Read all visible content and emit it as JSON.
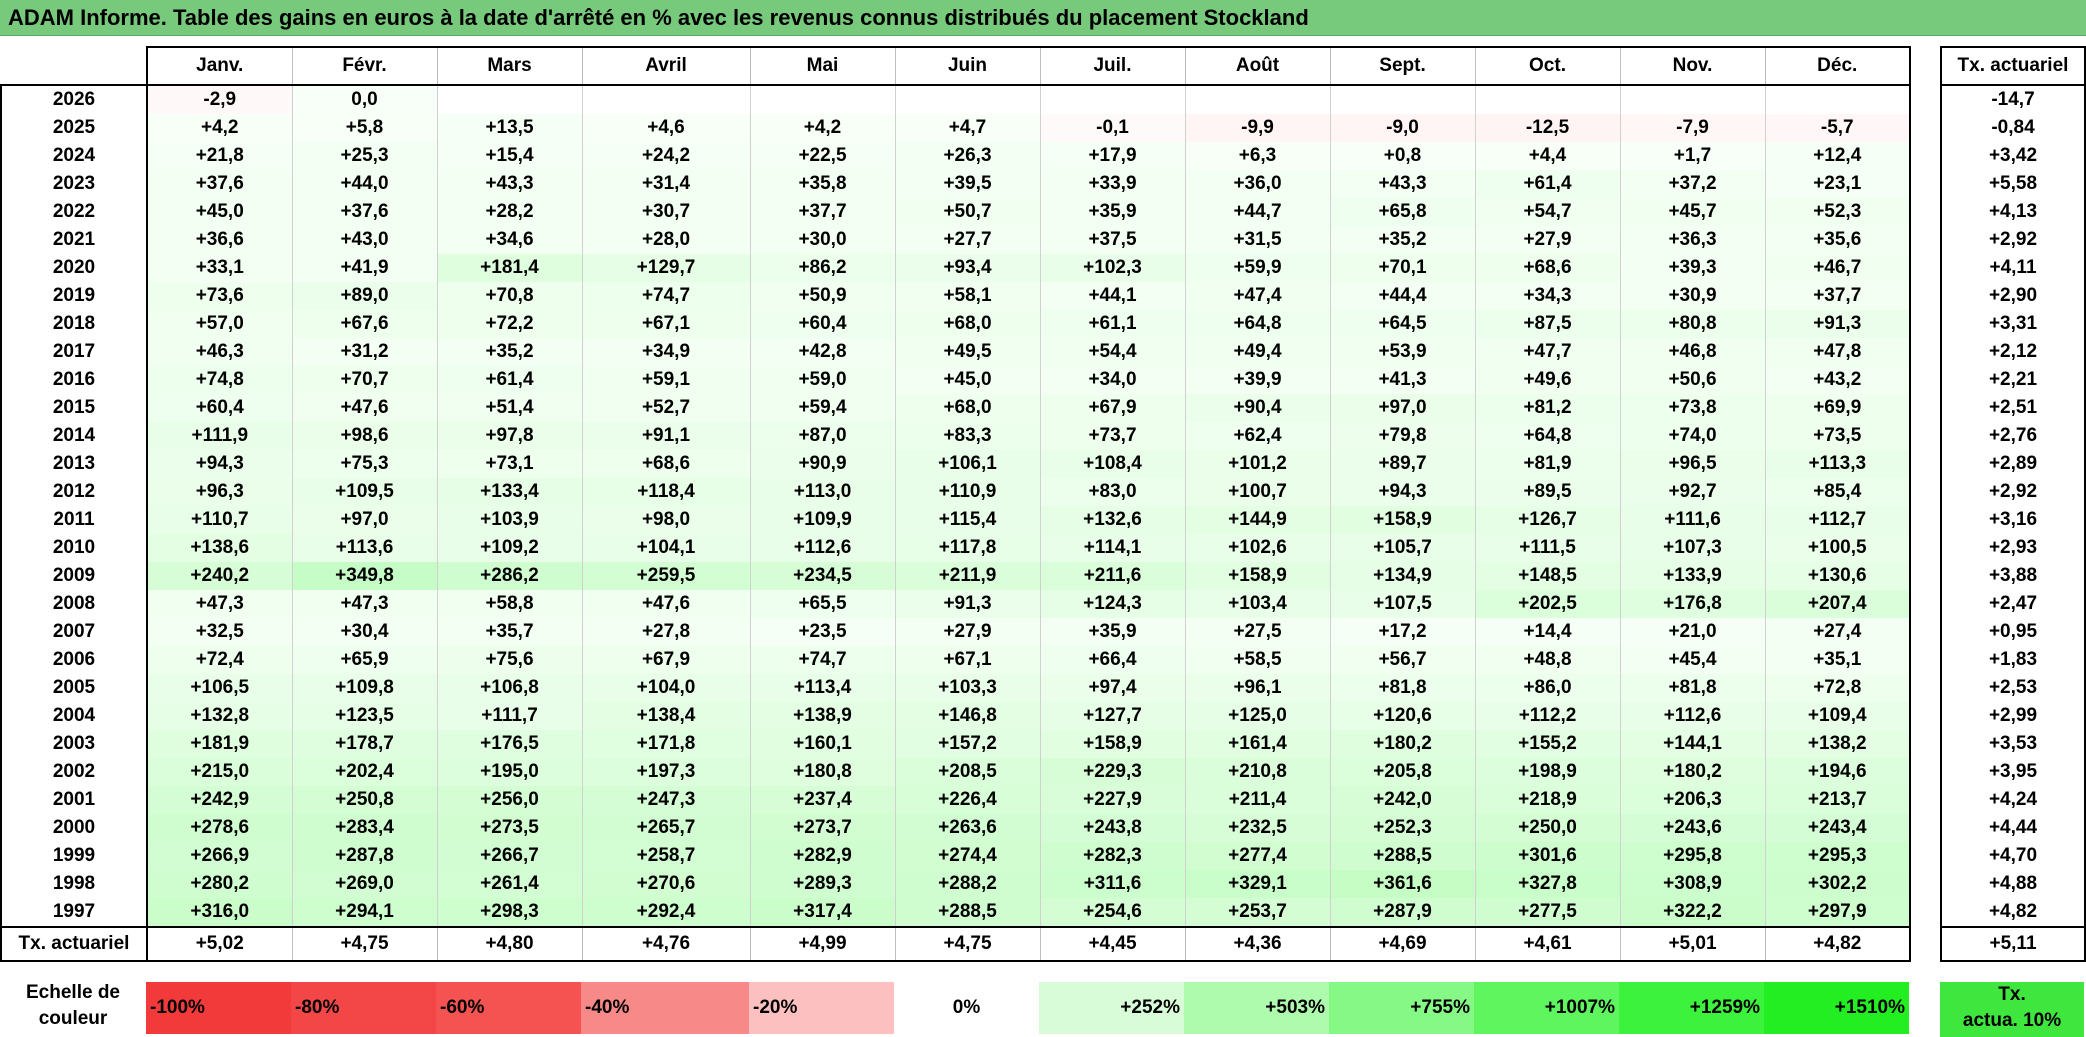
{
  "title": "ADAM Informe. Table des gains en euros à la date d'arrêté en % avec les revenus connus distribués du placement Stockland",
  "colors": {
    "title_bg": "#77c97b",
    "rate_extra_bg": "#3ee63e"
  },
  "chart_data": {
    "type": "table",
    "title": "ADAM Informe. Table des gains en euros à la date d'arrêté en % avec les revenus connus distribués du placement Stockland",
    "months": [
      "Janv.",
      "Févr.",
      "Mars",
      "Avril",
      "Mai",
      "Juin",
      "Juil.",
      "Août",
      "Sept.",
      "Oct.",
      "Nov.",
      "Déc."
    ],
    "rate_header": "Tx. actuariel",
    "rows": [
      {
        "year": "2026",
        "values": [
          "-2,9",
          "0,0",
          "",
          "",
          "",
          "",
          "",
          "",
          "",
          "",
          "",
          ""
        ],
        "rate": "-14,7"
      },
      {
        "year": "2025",
        "values": [
          "+4,2",
          "+5,8",
          "+13,5",
          "+4,6",
          "+4,2",
          "+4,7",
          "-0,1",
          "-9,9",
          "-9,0",
          "-12,5",
          "-7,9",
          "-5,7"
        ],
        "rate": "-0,84"
      },
      {
        "year": "2024",
        "values": [
          "+21,8",
          "+25,3",
          "+15,4",
          "+24,2",
          "+22,5",
          "+26,3",
          "+17,9",
          "+6,3",
          "+0,8",
          "+4,4",
          "+1,7",
          "+12,4"
        ],
        "rate": "+3,42"
      },
      {
        "year": "2023",
        "values": [
          "+37,6",
          "+44,0",
          "+43,3",
          "+31,4",
          "+35,8",
          "+39,5",
          "+33,9",
          "+36,0",
          "+43,3",
          "+61,4",
          "+37,2",
          "+23,1"
        ],
        "rate": "+5,58"
      },
      {
        "year": "2022",
        "values": [
          "+45,0",
          "+37,6",
          "+28,2",
          "+30,7",
          "+37,7",
          "+50,7",
          "+35,9",
          "+44,7",
          "+65,8",
          "+54,7",
          "+45,7",
          "+52,3"
        ],
        "rate": "+4,13"
      },
      {
        "year": "2021",
        "values": [
          "+36,6",
          "+43,0",
          "+34,6",
          "+28,0",
          "+30,0",
          "+27,7",
          "+37,5",
          "+31,5",
          "+35,2",
          "+27,9",
          "+36,3",
          "+35,6"
        ],
        "rate": "+2,92"
      },
      {
        "year": "2020",
        "values": [
          "+33,1",
          "+41,9",
          "+181,4",
          "+129,7",
          "+86,2",
          "+93,4",
          "+102,3",
          "+59,9",
          "+70,1",
          "+68,6",
          "+39,3",
          "+46,7"
        ],
        "rate": "+4,11"
      },
      {
        "year": "2019",
        "values": [
          "+73,6",
          "+89,0",
          "+70,8",
          "+74,7",
          "+50,9",
          "+58,1",
          "+44,1",
          "+47,4",
          "+44,4",
          "+34,3",
          "+30,9",
          "+37,7"
        ],
        "rate": "+2,90"
      },
      {
        "year": "2018",
        "values": [
          "+57,0",
          "+67,6",
          "+72,2",
          "+67,1",
          "+60,4",
          "+68,0",
          "+61,1",
          "+64,8",
          "+64,5",
          "+87,5",
          "+80,8",
          "+91,3"
        ],
        "rate": "+3,31"
      },
      {
        "year": "2017",
        "values": [
          "+46,3",
          "+31,2",
          "+35,2",
          "+34,9",
          "+42,8",
          "+49,5",
          "+54,4",
          "+49,4",
          "+53,9",
          "+47,7",
          "+46,8",
          "+47,8"
        ],
        "rate": "+2,12"
      },
      {
        "year": "2016",
        "values": [
          "+74,8",
          "+70,7",
          "+61,4",
          "+59,1",
          "+59,0",
          "+45,0",
          "+34,0",
          "+39,9",
          "+41,3",
          "+49,6",
          "+50,6",
          "+43,2"
        ],
        "rate": "+2,21"
      },
      {
        "year": "2015",
        "values": [
          "+60,4",
          "+47,6",
          "+51,4",
          "+52,7",
          "+59,4",
          "+68,0",
          "+67,9",
          "+90,4",
          "+97,0",
          "+81,2",
          "+73,8",
          "+69,9"
        ],
        "rate": "+2,51"
      },
      {
        "year": "2014",
        "values": [
          "+111,9",
          "+98,6",
          "+97,8",
          "+91,1",
          "+87,0",
          "+83,3",
          "+73,7",
          "+62,4",
          "+79,8",
          "+64,8",
          "+74,0",
          "+73,5"
        ],
        "rate": "+2,76"
      },
      {
        "year": "2013",
        "values": [
          "+94,3",
          "+75,3",
          "+73,1",
          "+68,6",
          "+90,9",
          "+106,1",
          "+108,4",
          "+101,2",
          "+89,7",
          "+81,9",
          "+96,5",
          "+113,3"
        ],
        "rate": "+2,89"
      },
      {
        "year": "2012",
        "values": [
          "+96,3",
          "+109,5",
          "+133,4",
          "+118,4",
          "+113,0",
          "+110,9",
          "+83,0",
          "+100,7",
          "+94,3",
          "+89,5",
          "+92,7",
          "+85,4"
        ],
        "rate": "+2,92"
      },
      {
        "year": "2011",
        "values": [
          "+110,7",
          "+97,0",
          "+103,9",
          "+98,0",
          "+109,9",
          "+115,4",
          "+132,6",
          "+144,9",
          "+158,9",
          "+126,7",
          "+111,6",
          "+112,7"
        ],
        "rate": "+3,16"
      },
      {
        "year": "2010",
        "values": [
          "+138,6",
          "+113,6",
          "+109,2",
          "+104,1",
          "+112,6",
          "+117,8",
          "+114,1",
          "+102,6",
          "+105,7",
          "+111,5",
          "+107,3",
          "+100,5"
        ],
        "rate": "+2,93"
      },
      {
        "year": "2009",
        "values": [
          "+240,2",
          "+349,8",
          "+286,2",
          "+259,5",
          "+234,5",
          "+211,9",
          "+211,6",
          "+158,9",
          "+134,9",
          "+148,5",
          "+133,9",
          "+130,6"
        ],
        "rate": "+3,88"
      },
      {
        "year": "2008",
        "values": [
          "+47,3",
          "+47,3",
          "+58,8",
          "+47,6",
          "+65,5",
          "+91,3",
          "+124,3",
          "+103,4",
          "+107,5",
          "+202,5",
          "+176,8",
          "+207,4"
        ],
        "rate": "+2,47"
      },
      {
        "year": "2007",
        "values": [
          "+32,5",
          "+30,4",
          "+35,7",
          "+27,8",
          "+23,5",
          "+27,9",
          "+35,9",
          "+27,5",
          "+17,2",
          "+14,4",
          "+21,0",
          "+27,4"
        ],
        "rate": "+0,95"
      },
      {
        "year": "2006",
        "values": [
          "+72,4",
          "+65,9",
          "+75,6",
          "+67,9",
          "+74,7",
          "+67,1",
          "+66,4",
          "+58,5",
          "+56,7",
          "+48,8",
          "+45,4",
          "+35,1"
        ],
        "rate": "+1,83"
      },
      {
        "year": "2005",
        "values": [
          "+106,5",
          "+109,8",
          "+106,8",
          "+104,0",
          "+113,4",
          "+103,3",
          "+97,4",
          "+96,1",
          "+81,8",
          "+86,0",
          "+81,8",
          "+72,8"
        ],
        "rate": "+2,53"
      },
      {
        "year": "2004",
        "values": [
          "+132,8",
          "+123,5",
          "+111,7",
          "+138,4",
          "+138,9",
          "+146,8",
          "+127,7",
          "+125,0",
          "+120,6",
          "+112,2",
          "+112,6",
          "+109,4"
        ],
        "rate": "+2,99"
      },
      {
        "year": "2003",
        "values": [
          "+181,9",
          "+178,7",
          "+176,5",
          "+171,8",
          "+160,1",
          "+157,2",
          "+158,9",
          "+161,4",
          "+180,2",
          "+155,2",
          "+144,1",
          "+138,2"
        ],
        "rate": "+3,53"
      },
      {
        "year": "2002",
        "values": [
          "+215,0",
          "+202,4",
          "+195,0",
          "+197,3",
          "+180,8",
          "+208,5",
          "+229,3",
          "+210,8",
          "+205,8",
          "+198,9",
          "+180,2",
          "+194,6"
        ],
        "rate": "+3,95"
      },
      {
        "year": "2001",
        "values": [
          "+242,9",
          "+250,8",
          "+256,0",
          "+247,3",
          "+237,4",
          "+226,4",
          "+227,9",
          "+211,4",
          "+242,0",
          "+218,9",
          "+206,3",
          "+213,7"
        ],
        "rate": "+4,24"
      },
      {
        "year": "2000",
        "values": [
          "+278,6",
          "+283,4",
          "+273,5",
          "+265,7",
          "+273,7",
          "+263,6",
          "+243,8",
          "+232,5",
          "+252,3",
          "+250,0",
          "+243,6",
          "+243,4"
        ],
        "rate": "+4,44"
      },
      {
        "year": "1999",
        "values": [
          "+266,9",
          "+287,8",
          "+266,7",
          "+258,7",
          "+282,9",
          "+274,4",
          "+282,3",
          "+277,4",
          "+288,5",
          "+301,6",
          "+295,8",
          "+295,3"
        ],
        "rate": "+4,70"
      },
      {
        "year": "1998",
        "values": [
          "+280,2",
          "+269,0",
          "+261,4",
          "+270,6",
          "+289,3",
          "+288,2",
          "+311,6",
          "+329,1",
          "+361,6",
          "+327,8",
          "+308,9",
          "+302,2"
        ],
        "rate": "+4,88"
      },
      {
        "year": "1997",
        "values": [
          "+316,0",
          "+294,1",
          "+298,3",
          "+292,4",
          "+317,4",
          "+288,5",
          "+254,6",
          "+253,7",
          "+287,9",
          "+277,5",
          "+322,2",
          "+297,9"
        ],
        "rate": "+4,82"
      }
    ],
    "footer": {
      "label": "Tx. actuariel",
      "values": [
        "+5,02",
        "+4,75",
        "+4,80",
        "+4,76",
        "+4,99",
        "+4,75",
        "+4,45",
        "+4,36",
        "+4,69",
        "+4,61",
        "+5,01",
        "+4,82"
      ],
      "rate": "+5,11"
    },
    "color_scale": {
      "label_line1": "Echelle de",
      "label_line2": "couleur",
      "steps": [
        {
          "label": "-100%",
          "color": "#f23a3a"
        },
        {
          "label": "-80%",
          "color": "#f34646"
        },
        {
          "label": "-60%",
          "color": "#f55252"
        },
        {
          "label": "-40%",
          "color": "#f88989"
        },
        {
          "label": "-20%",
          "color": "#fcc0c0"
        },
        {
          "label": "0%",
          "color": "#ffffff"
        },
        {
          "label": "+252%",
          "color": "#d7fcd7"
        },
        {
          "label": "+503%",
          "color": "#aefbae"
        },
        {
          "label": "+755%",
          "color": "#86f886"
        },
        {
          "label": "+1007%",
          "color": "#5ef55e"
        },
        {
          "label": "+1259%",
          "color": "#3cf23c"
        },
        {
          "label": "+1510%",
          "color": "#22ee22"
        }
      ],
      "extra_line1": "Tx.",
      "extra_line2": "actua. 10%"
    }
  }
}
